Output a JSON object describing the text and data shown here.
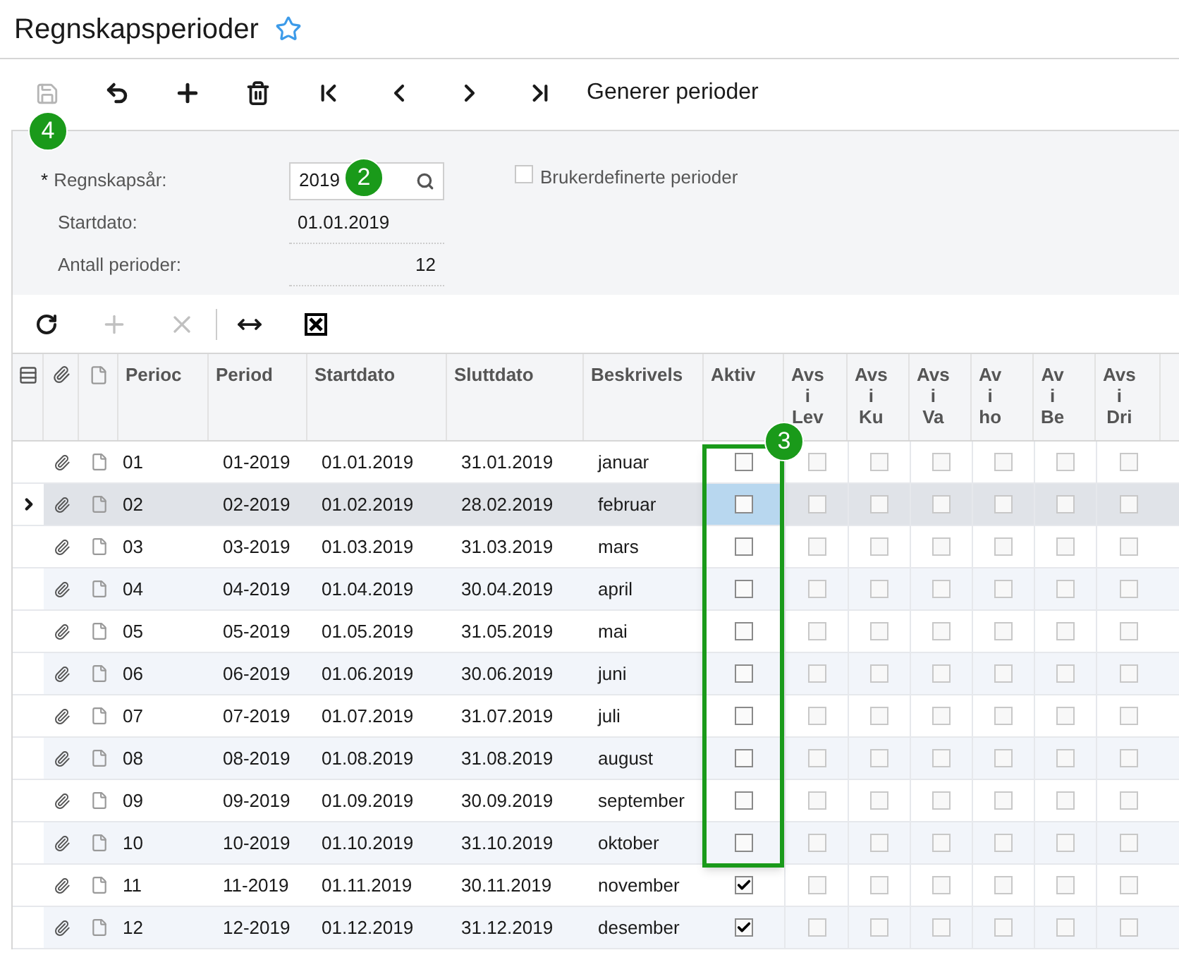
{
  "page": {
    "title": "Regnskapsperioder",
    "favorite": false
  },
  "toolbar": {
    "save_disabled": true,
    "action": "Generer perioder"
  },
  "form": {
    "year_label": "Regnskapsår:",
    "required_mark": "*",
    "year_value": "2019",
    "start_label": "Startdato:",
    "start_value": "01.01.2019",
    "count_label": "Antall perioder:",
    "count_value": "12",
    "custom_periods": {
      "label": "Brukerdefinerte perioder",
      "checked": false
    }
  },
  "callouts": [
    {
      "kind": "save",
      "text": "4"
    },
    {
      "kind": "year",
      "text": "2"
    },
    {
      "kind": "aktiv",
      "text": "3"
    }
  ],
  "table": {
    "columns": [
      "Perioc",
      "Period",
      "Startdato",
      "Sluttdato",
      "Beskrivels",
      "Aktiv",
      "Avs\ni\nLev",
      "Avs\ni\nKu",
      "Avs\ni\nVa",
      "Av\ni\nho",
      "Av\ni\nBe",
      "Avs\ni\nDri"
    ],
    "rows": [
      {
        "cells": [
          "01",
          "01-2019",
          "01.01.2019",
          "31.01.2019",
          "januar"
        ],
        "selected": false,
        "aktiv": false,
        "flags": [
          false,
          false,
          false,
          false,
          false,
          false
        ]
      },
      {
        "cells": [
          "02",
          "02-2019",
          "01.02.2019",
          "28.02.2019",
          "februar"
        ],
        "selected": true,
        "aktiv": false,
        "flags": [
          false,
          false,
          false,
          false,
          false,
          false
        ]
      },
      {
        "cells": [
          "03",
          "03-2019",
          "01.03.2019",
          "31.03.2019",
          "mars"
        ],
        "selected": false,
        "aktiv": false,
        "flags": [
          false,
          false,
          false,
          false,
          false,
          false
        ]
      },
      {
        "cells": [
          "04",
          "04-2019",
          "01.04.2019",
          "30.04.2019",
          "april"
        ],
        "selected": false,
        "aktiv": false,
        "flags": [
          false,
          false,
          false,
          false,
          false,
          false
        ]
      },
      {
        "cells": [
          "05",
          "05-2019",
          "01.05.2019",
          "31.05.2019",
          "mai"
        ],
        "selected": false,
        "aktiv": false,
        "flags": [
          false,
          false,
          false,
          false,
          false,
          false
        ]
      },
      {
        "cells": [
          "06",
          "06-2019",
          "01.06.2019",
          "30.06.2019",
          "juni"
        ],
        "selected": false,
        "aktiv": false,
        "flags": [
          false,
          false,
          false,
          false,
          false,
          false
        ]
      },
      {
        "cells": [
          "07",
          "07-2019",
          "01.07.2019",
          "31.07.2019",
          "juli"
        ],
        "selected": false,
        "aktiv": false,
        "flags": [
          false,
          false,
          false,
          false,
          false,
          false
        ]
      },
      {
        "cells": [
          "08",
          "08-2019",
          "01.08.2019",
          "31.08.2019",
          "august"
        ],
        "selected": false,
        "aktiv": false,
        "flags": [
          false,
          false,
          false,
          false,
          false,
          false
        ]
      },
      {
        "cells": [
          "09",
          "09-2019",
          "01.09.2019",
          "30.09.2019",
          "september"
        ],
        "selected": false,
        "aktiv": false,
        "flags": [
          false,
          false,
          false,
          false,
          false,
          false
        ]
      },
      {
        "cells": [
          "10",
          "10-2019",
          "01.10.2019",
          "31.10.2019",
          "oktober"
        ],
        "selected": false,
        "aktiv": false,
        "flags": [
          false,
          false,
          false,
          false,
          false,
          false
        ]
      },
      {
        "cells": [
          "11",
          "11-2019",
          "01.11.2019",
          "30.11.2019",
          "november"
        ],
        "selected": false,
        "aktiv": true,
        "flags": [
          false,
          false,
          false,
          false,
          false,
          false
        ]
      },
      {
        "cells": [
          "12",
          "12-2019",
          "01.12.2019",
          "31.12.2019",
          "desember"
        ],
        "selected": false,
        "aktiv": true,
        "flags": [
          false,
          false,
          false,
          false,
          false,
          false
        ]
      }
    ]
  }
}
